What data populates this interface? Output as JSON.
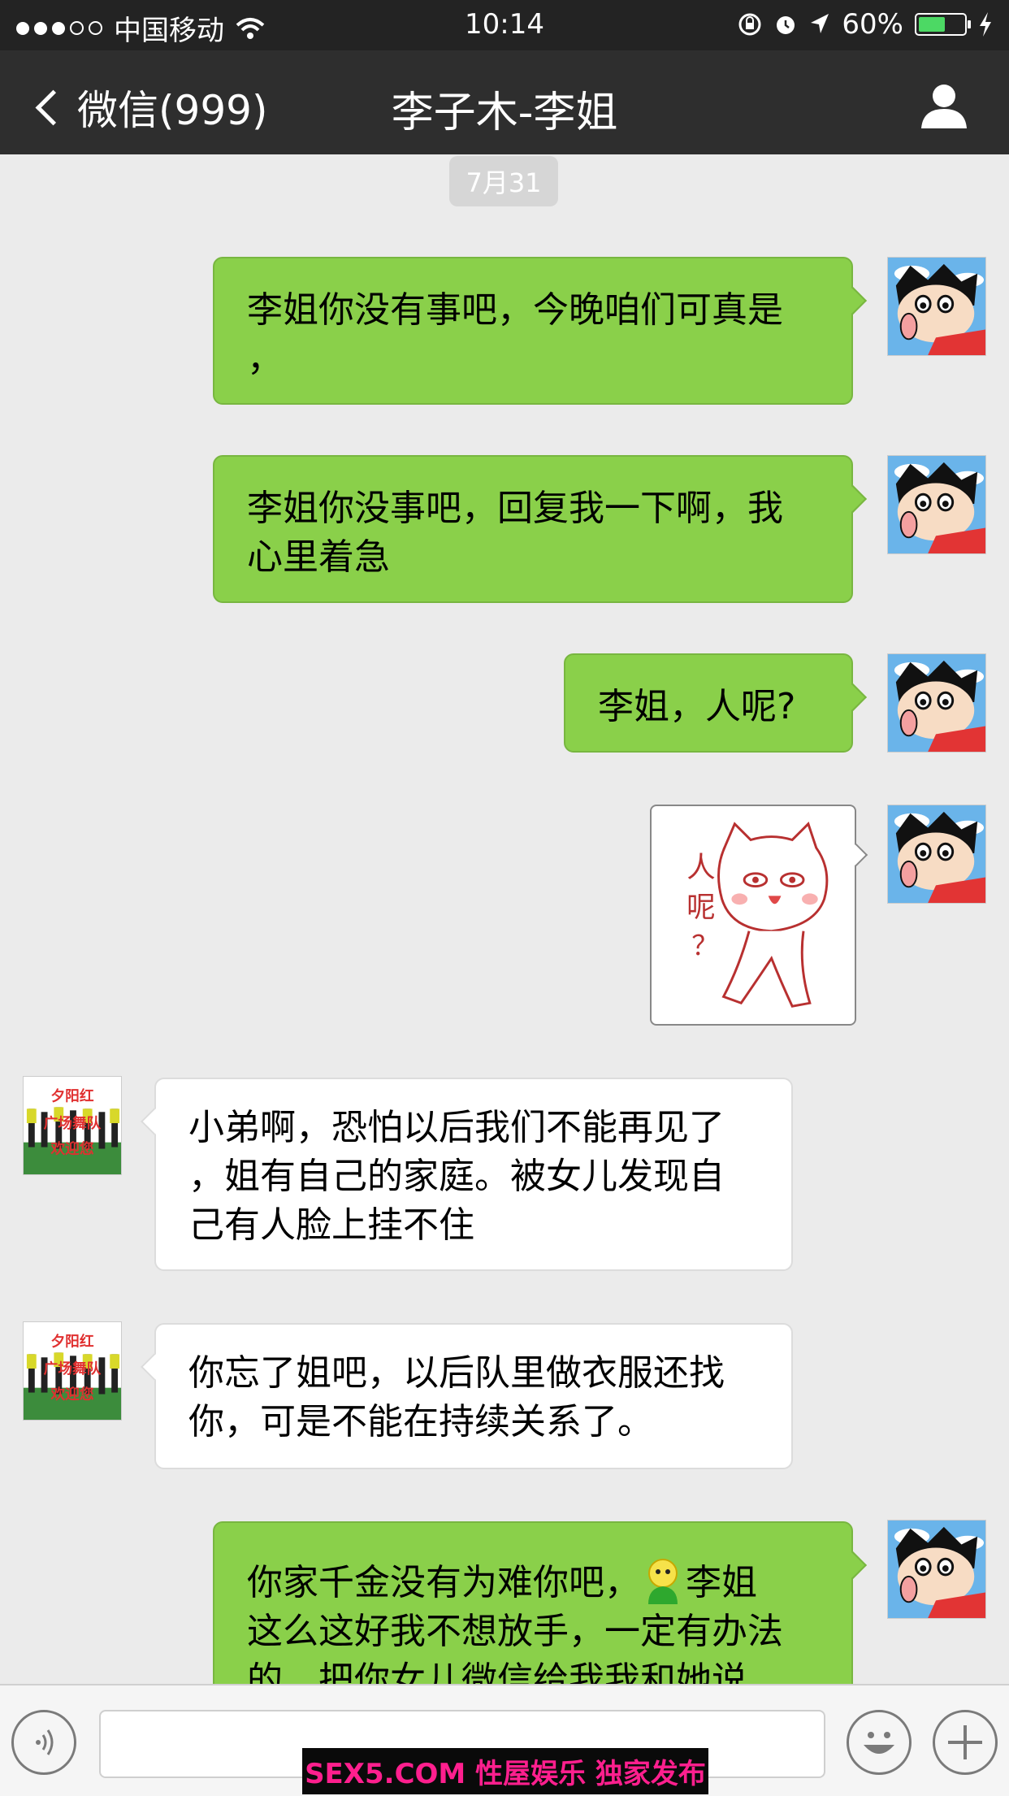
{
  "status_bar": {
    "carrier": "中国移动",
    "time": "10:14",
    "battery": "60%",
    "battery_level": 0.6
  },
  "nav": {
    "back_label": "微信(999)",
    "title": "李子木-李姐"
  },
  "date_label": "7月31",
  "messages": [
    {
      "dir": "out",
      "lines": [
        "李姐你没有事吧，今晚咱们可真是",
        "，"
      ]
    },
    {
      "dir": "out",
      "lines": [
        "李姐你没事吧，回复我一下啊，我",
        "心里着急"
      ]
    },
    {
      "dir": "out",
      "lines": [
        "李姐，人呢?"
      ]
    },
    {
      "dir": "out",
      "type": "sticker",
      "sticker_text": [
        "人",
        "呢",
        "？"
      ]
    },
    {
      "dir": "in",
      "lines": [
        "小弟啊，恐怕以后我们不能再见了",
        "，姐有自己的家庭。被女儿发现自",
        "己有人脸上挂不住"
      ]
    },
    {
      "dir": "in",
      "lines": [
        "你忘了姐吧，以后队里做衣服还找",
        "你，可是不能在持续关系了。"
      ]
    },
    {
      "dir": "out",
      "lines_before_emoji": "你家千金没有为难你吧，",
      "lines_after_emoji": "李姐",
      "lines": [
        "这么这好我不想放手，一定有办法",
        "的，把你女儿微信给我我和她说"
      ]
    }
  ],
  "contact_avatar_text": [
    "夕阳红",
    "广场舞队",
    "欢迎您"
  ],
  "watermark": "SEX5.COM 性屋娱乐 独家发布",
  "colors": {
    "outgoing_bubble": "#8ad04a",
    "incoming_bubble": "#ffffff",
    "navbar": "#2e2e2e",
    "chat_bg": "#ebebeb"
  },
  "icons": [
    "wifi-icon",
    "lock-rotation-icon",
    "alarm-icon",
    "location-icon",
    "charging-icon",
    "back-chevron-icon",
    "profile-icon",
    "voice-icon",
    "emoji-icon",
    "plus-icon"
  ]
}
